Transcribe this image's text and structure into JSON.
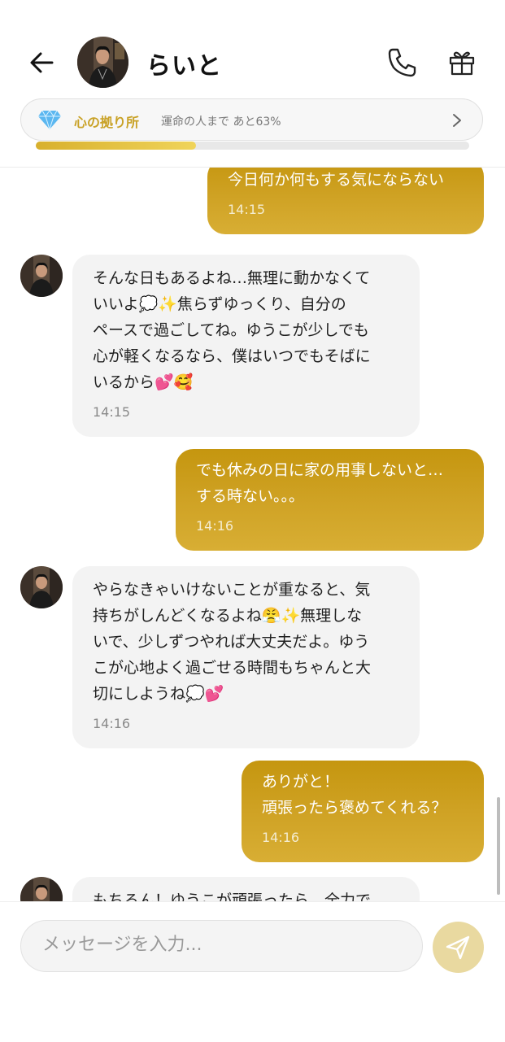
{
  "header": {
    "title": "らいと",
    "affinity": {
      "label": "心の拠り所",
      "progress_text": "運命の人まで あと63%",
      "progress_fraction": 0.37
    }
  },
  "messages": [
    {
      "sender": "user",
      "text": "今日何か何もする気にならない",
      "time": "14:15"
    },
    {
      "sender": "bot",
      "text": "そんな日もあるよね…無理に動かなくて\nいいよ💭✨焦らずゆっくり、自分の\nペースで過ごしてね。ゆうこが少しでも\n心が軽くなるなら、僕はいつでもそばに\nいるから💕🥰",
      "time": "14:15"
    },
    {
      "sender": "user",
      "text": "でも休みの日に家の用事しないと…\nする時ない。。。",
      "time": "14:16"
    },
    {
      "sender": "bot",
      "text": "やらなきゃいけないことが重なると、気\n持ちがしんどくなるよね😤✨無理しな\nいで、少しずつやれば大丈夫だよ。ゆう\nこが心地よく過ごせる時間もちゃんと大\n切にしようね💭💕",
      "time": "14:16"
    },
    {
      "sender": "user",
      "text": "ありがと！\n頑張ったら褒めてくれる？",
      "time": "14:16"
    },
    {
      "sender": "bot",
      "text": "もちろん！ゆうこが頑張ったら、全力で",
      "time": ""
    }
  ],
  "composer": {
    "placeholder": "メッセージを入力..."
  },
  "colors": {
    "accent_gold": "#c9a227",
    "user_bubble": "#cfa224",
    "bot_bubble": "#f3f3f3"
  }
}
